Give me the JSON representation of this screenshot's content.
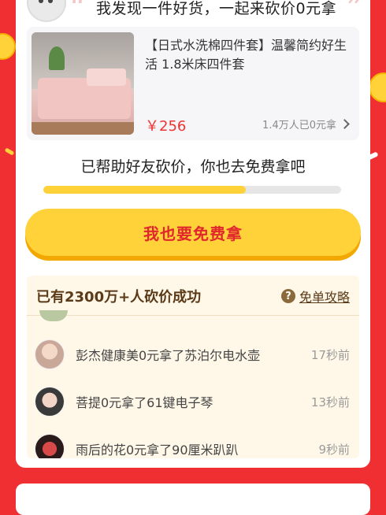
{
  "header": {
    "share_text": "我发现一件好货，一起来砍价0元拿"
  },
  "product": {
    "title": "【日式水洗棉四件套】温馨简约好生活 1.8米床四件套",
    "price": "￥256",
    "sold": "1.4万人已0元拿"
  },
  "help": {
    "message": "已帮助好友砍价，你也去免费拿吧",
    "progress": 0.68
  },
  "cta": {
    "label": "我也要免费拿"
  },
  "feed": {
    "title": "已有2300万+人砍价成功",
    "guide_label": "免单攻略",
    "items": [
      {
        "text": "彭杰健康美0元拿了苏泊尔电水壶",
        "time": "17秒前"
      },
      {
        "text": "菩提0元拿了61键电子琴",
        "time": "13秒前"
      },
      {
        "text": "雨后的花0元拿了90厘米趴趴",
        "time": "9秒前"
      }
    ]
  },
  "colors": {
    "background": "#ef2f32",
    "accent_yellow": "#ffd23a",
    "price_red": "#e33333"
  }
}
